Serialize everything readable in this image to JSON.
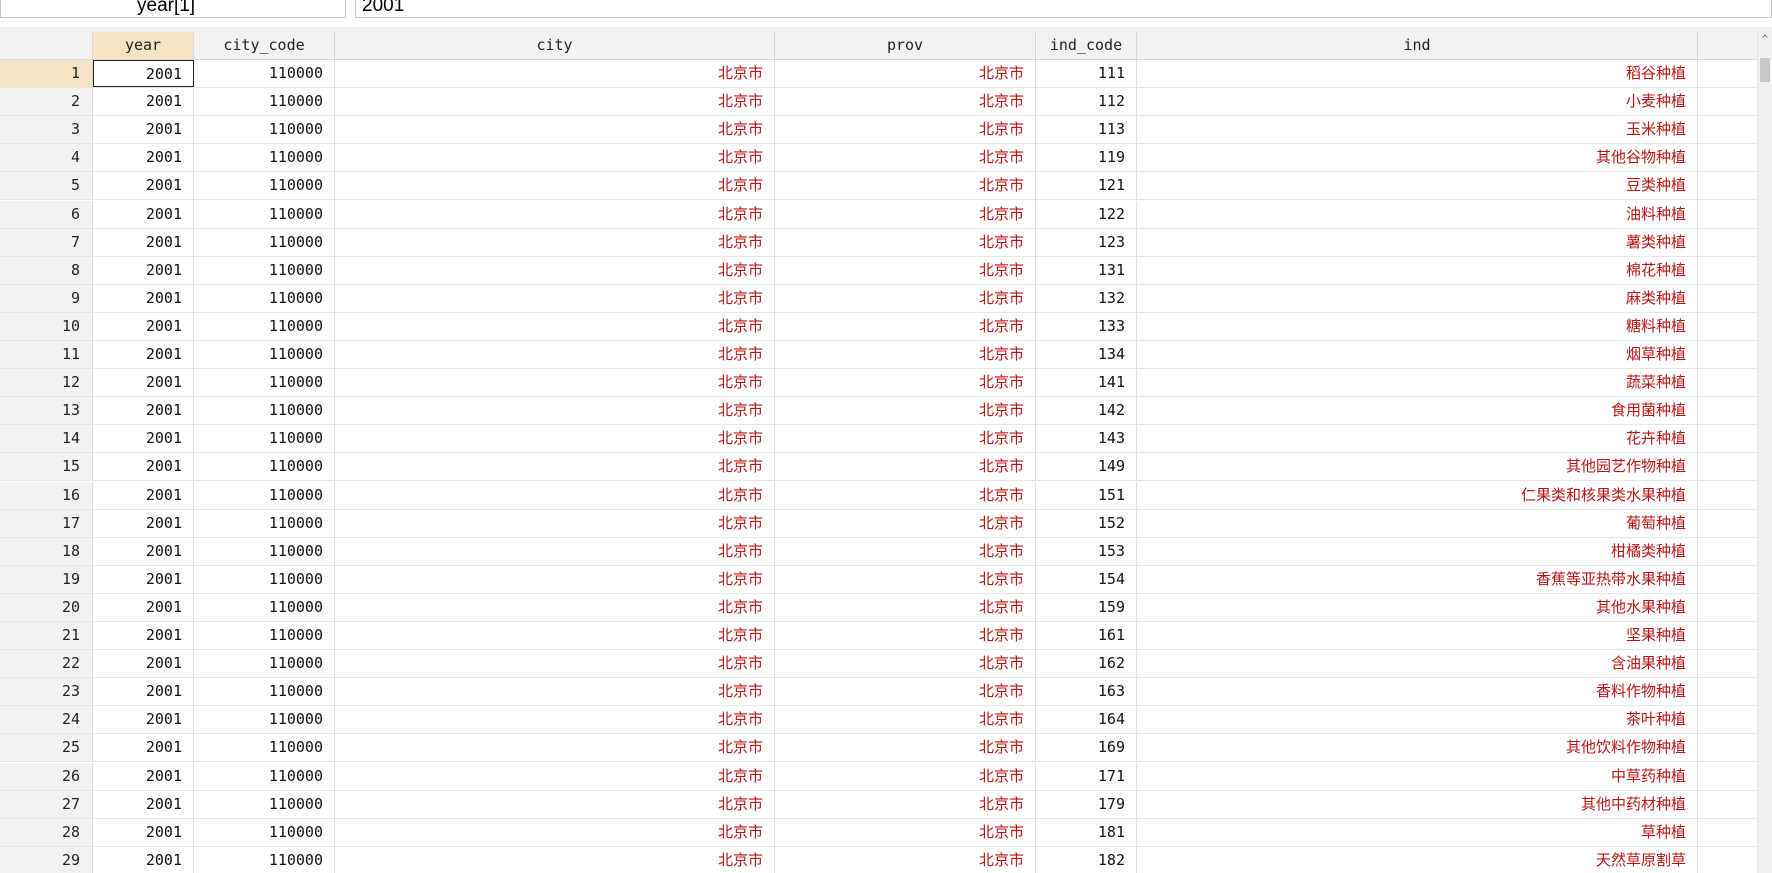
{
  "expression_bar": {
    "variable": "year[1]",
    "value": "2001"
  },
  "columns": [
    "year",
    "city_code",
    "city",
    "prov",
    "ind_code",
    "ind"
  ],
  "rows": [
    {
      "n": "1",
      "year": "2001",
      "city_code": "110000",
      "city": "北京市",
      "prov": "北京市",
      "ind_code": "111",
      "ind": "稻谷种植"
    },
    {
      "n": "2",
      "year": "2001",
      "city_code": "110000",
      "city": "北京市",
      "prov": "北京市",
      "ind_code": "112",
      "ind": "小麦种植"
    },
    {
      "n": "3",
      "year": "2001",
      "city_code": "110000",
      "city": "北京市",
      "prov": "北京市",
      "ind_code": "113",
      "ind": "玉米种植"
    },
    {
      "n": "4",
      "year": "2001",
      "city_code": "110000",
      "city": "北京市",
      "prov": "北京市",
      "ind_code": "119",
      "ind": "其他谷物种植"
    },
    {
      "n": "5",
      "year": "2001",
      "city_code": "110000",
      "city": "北京市",
      "prov": "北京市",
      "ind_code": "121",
      "ind": "豆类种植"
    },
    {
      "n": "6",
      "year": "2001",
      "city_code": "110000",
      "city": "北京市",
      "prov": "北京市",
      "ind_code": "122",
      "ind": "油料种植"
    },
    {
      "n": "7",
      "year": "2001",
      "city_code": "110000",
      "city": "北京市",
      "prov": "北京市",
      "ind_code": "123",
      "ind": "薯类种植"
    },
    {
      "n": "8",
      "year": "2001",
      "city_code": "110000",
      "city": "北京市",
      "prov": "北京市",
      "ind_code": "131",
      "ind": "棉花种植"
    },
    {
      "n": "9",
      "year": "2001",
      "city_code": "110000",
      "city": "北京市",
      "prov": "北京市",
      "ind_code": "132",
      "ind": "麻类种植"
    },
    {
      "n": "10",
      "year": "2001",
      "city_code": "110000",
      "city": "北京市",
      "prov": "北京市",
      "ind_code": "133",
      "ind": "糖料种植"
    },
    {
      "n": "11",
      "year": "2001",
      "city_code": "110000",
      "city": "北京市",
      "prov": "北京市",
      "ind_code": "134",
      "ind": "烟草种植"
    },
    {
      "n": "12",
      "year": "2001",
      "city_code": "110000",
      "city": "北京市",
      "prov": "北京市",
      "ind_code": "141",
      "ind": "蔬菜种植"
    },
    {
      "n": "13",
      "year": "2001",
      "city_code": "110000",
      "city": "北京市",
      "prov": "北京市",
      "ind_code": "142",
      "ind": "食用菌种植"
    },
    {
      "n": "14",
      "year": "2001",
      "city_code": "110000",
      "city": "北京市",
      "prov": "北京市",
      "ind_code": "143",
      "ind": "花卉种植"
    },
    {
      "n": "15",
      "year": "2001",
      "city_code": "110000",
      "city": "北京市",
      "prov": "北京市",
      "ind_code": "149",
      "ind": "其他园艺作物种植"
    },
    {
      "n": "16",
      "year": "2001",
      "city_code": "110000",
      "city": "北京市",
      "prov": "北京市",
      "ind_code": "151",
      "ind": "仁果类和核果类水果种植"
    },
    {
      "n": "17",
      "year": "2001",
      "city_code": "110000",
      "city": "北京市",
      "prov": "北京市",
      "ind_code": "152",
      "ind": "葡萄种植"
    },
    {
      "n": "18",
      "year": "2001",
      "city_code": "110000",
      "city": "北京市",
      "prov": "北京市",
      "ind_code": "153",
      "ind": "柑橘类种植"
    },
    {
      "n": "19",
      "year": "2001",
      "city_code": "110000",
      "city": "北京市",
      "prov": "北京市",
      "ind_code": "154",
      "ind": "香蕉等亚热带水果种植"
    },
    {
      "n": "20",
      "year": "2001",
      "city_code": "110000",
      "city": "北京市",
      "prov": "北京市",
      "ind_code": "159",
      "ind": "其他水果种植"
    },
    {
      "n": "21",
      "year": "2001",
      "city_code": "110000",
      "city": "北京市",
      "prov": "北京市",
      "ind_code": "161",
      "ind": "坚果种植"
    },
    {
      "n": "22",
      "year": "2001",
      "city_code": "110000",
      "city": "北京市",
      "prov": "北京市",
      "ind_code": "162",
      "ind": "含油果种植"
    },
    {
      "n": "23",
      "year": "2001",
      "city_code": "110000",
      "city": "北京市",
      "prov": "北京市",
      "ind_code": "163",
      "ind": "香料作物种植"
    },
    {
      "n": "24",
      "year": "2001",
      "city_code": "110000",
      "city": "北京市",
      "prov": "北京市",
      "ind_code": "164",
      "ind": "茶叶种植"
    },
    {
      "n": "25",
      "year": "2001",
      "city_code": "110000",
      "city": "北京市",
      "prov": "北京市",
      "ind_code": "169",
      "ind": "其他饮料作物种植"
    },
    {
      "n": "26",
      "year": "2001",
      "city_code": "110000",
      "city": "北京市",
      "prov": "北京市",
      "ind_code": "171",
      "ind": "中草药种植"
    },
    {
      "n": "27",
      "year": "2001",
      "city_code": "110000",
      "city": "北京市",
      "prov": "北京市",
      "ind_code": "179",
      "ind": "其他中药材种植"
    },
    {
      "n": "28",
      "year": "2001",
      "city_code": "110000",
      "city": "北京市",
      "prov": "北京市",
      "ind_code": "181",
      "ind": "草种植"
    },
    {
      "n": "29",
      "year": "2001",
      "city_code": "110000",
      "city": "北京市",
      "prov": "北京市",
      "ind_code": "182",
      "ind": "天然草原割草"
    }
  ],
  "colors": {
    "string_text": "#b81414",
    "selected_header": "#f5e4c4"
  },
  "icons": {
    "scroll_up": "chevron-up-icon"
  }
}
